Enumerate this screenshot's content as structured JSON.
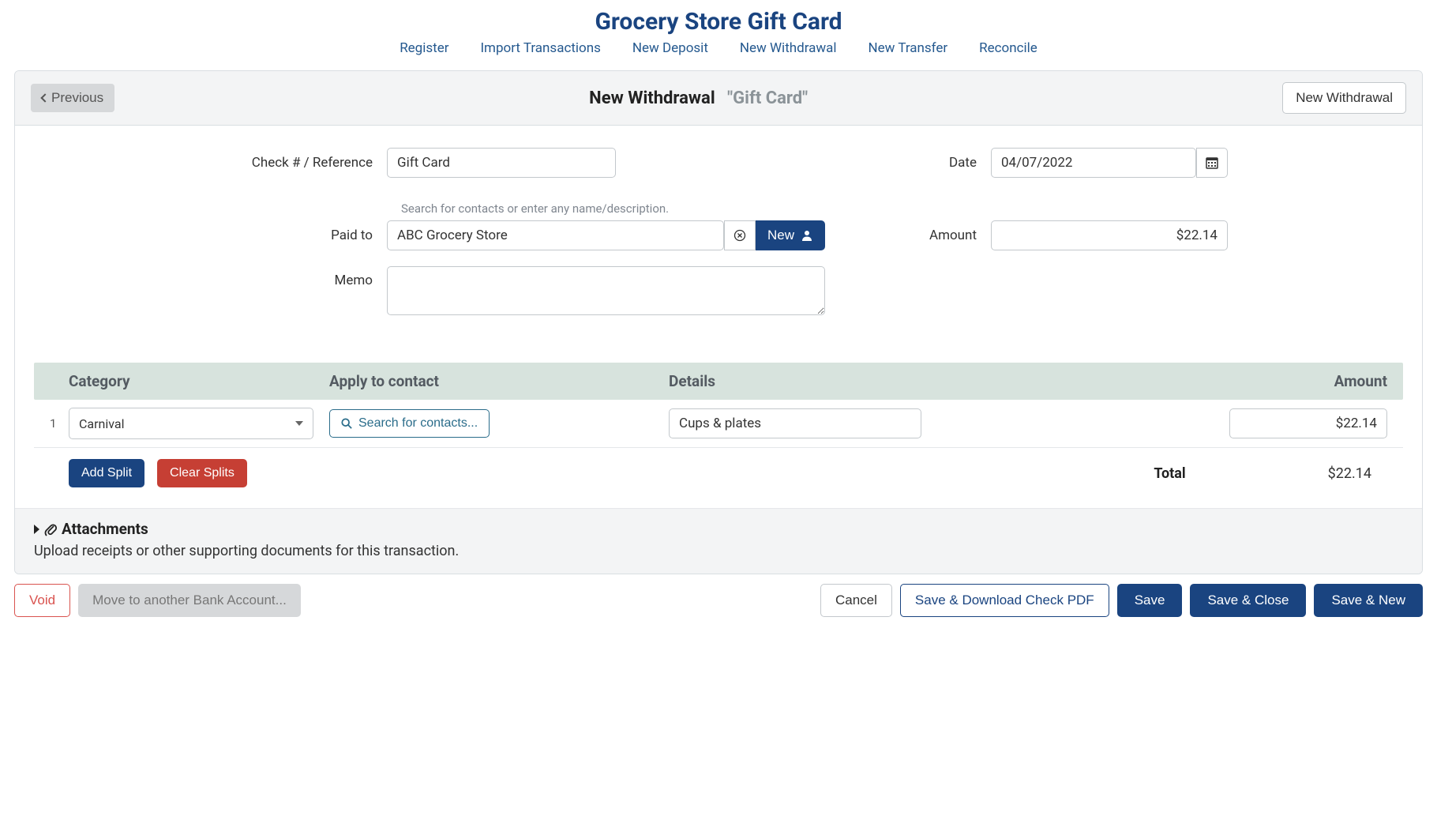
{
  "page_title": "Grocery Store Gift Card",
  "nav": [
    "Register",
    "Import Transactions",
    "New Deposit",
    "New Withdrawal",
    "New Transfer",
    "Reconcile"
  ],
  "header": {
    "previous": "Previous",
    "title": "New Withdrawal",
    "subtitle": "\"Gift Card\"",
    "new_withdrawal_btn": "New Withdrawal"
  },
  "form": {
    "check_label": "Check # / Reference",
    "check_value": "Gift Card",
    "date_label": "Date",
    "date_value": "04/07/2022",
    "paidto_hint": "Search for contacts or enter any name/description.",
    "paidto_label": "Paid to",
    "paidto_value": "ABC Grocery Store",
    "new_contact_btn": "New",
    "amount_label": "Amount",
    "amount_value": "$22.14",
    "memo_label": "Memo",
    "memo_value": ""
  },
  "splits": {
    "headers": {
      "category": "Category",
      "apply": "Apply to contact",
      "details": "Details",
      "amount": "Amount"
    },
    "rows": [
      {
        "num": "1",
        "category": "Carnival",
        "contact_search": "Search for contacts...",
        "details": "Cups & plates",
        "amount": "$22.14"
      }
    ],
    "add_split": "Add Split",
    "clear_splits": "Clear Splits",
    "total_label": "Total",
    "total_value": "$22.14"
  },
  "attachments": {
    "title": "Attachments",
    "desc": "Upload receipts or other supporting documents for this transaction."
  },
  "footer": {
    "void": "Void",
    "move": "Move to another Bank Account...",
    "cancel": "Cancel",
    "save_download": "Save & Download Check PDF",
    "save": "Save",
    "save_close": "Save & Close",
    "save_new": "Save & New"
  }
}
